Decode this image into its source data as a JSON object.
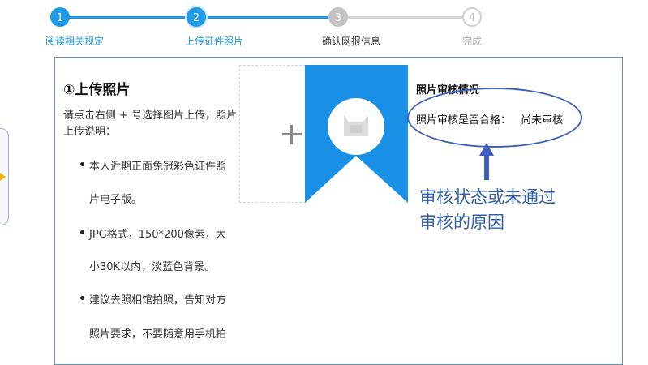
{
  "stepper": {
    "steps": [
      {
        "number": "1",
        "label": "阅读相关规定",
        "state": "done"
      },
      {
        "number": "2",
        "label": "上传证件照片",
        "state": "current"
      },
      {
        "number": "3",
        "label": "确认网报信息",
        "state": "pending"
      },
      {
        "number": "4",
        "label": "完成",
        "state": "inactive"
      }
    ],
    "colors": {
      "active": "#1e9ae6",
      "pending": "#b5b5b5",
      "inactive": "#d0d0d0"
    }
  },
  "upload": {
    "title": "①上传照片",
    "instruction": "请点击右侧 + 号选择图片上传，照片上传说明：",
    "bullet_lines": [
      "本人近期正面免冠彩色证件照",
      "片电子版。",
      "JPG格式，150*200像素，大",
      "小30K以内，淡蓝色背景。",
      "建议去照相馆拍照，告知对方",
      "照片要求，不要随意用手机拍"
    ],
    "add_icon": "plus-icon",
    "preview_icon": "id-photo-placeholder-icon",
    "preview_color": "#1a8fe6"
  },
  "review": {
    "title": "照片审核情况",
    "label": "照片审核是否合格：",
    "status": "尚未审核"
  },
  "annotation": {
    "text_line1": "审核状态或未通过",
    "text_line2": "审核的原因",
    "color": "#3d5fbd"
  }
}
